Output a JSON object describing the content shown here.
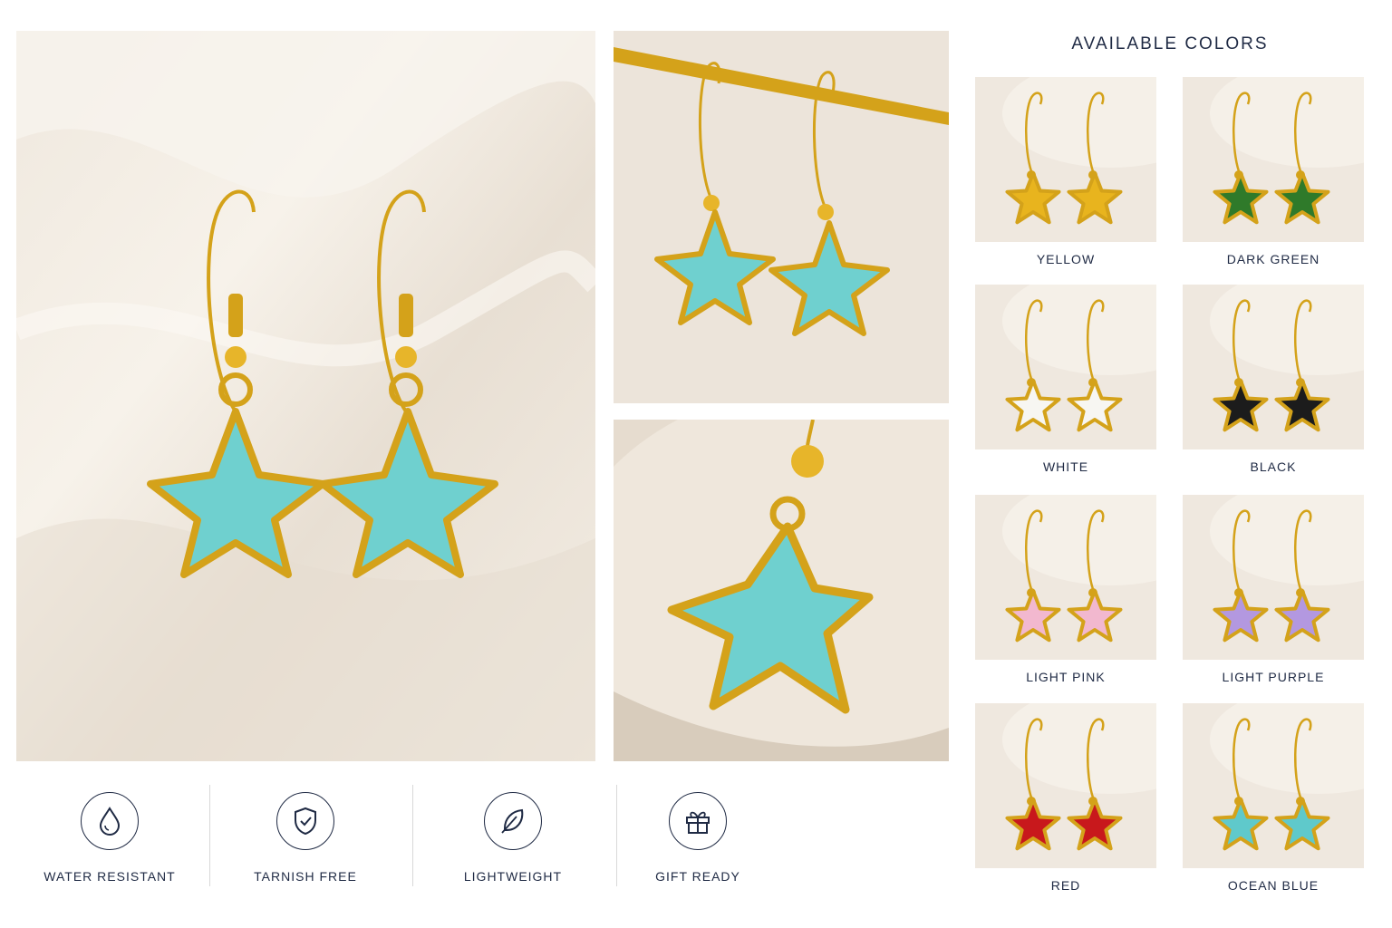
{
  "colors_section": {
    "title": "AVAILABLE COLORS",
    "options": [
      {
        "label": "YELLOW",
        "hex": "#e8b41e"
      },
      {
        "label": "DARK GREEN",
        "hex": "#2f7a2a"
      },
      {
        "label": "WHITE",
        "hex": "#f7f6f2"
      },
      {
        "label": "BLACK",
        "hex": "#1c1c1c"
      },
      {
        "label": "LIGHT PINK",
        "hex": "#f2b8cf"
      },
      {
        "label": "LIGHT PURPLE",
        "hex": "#b398e0"
      },
      {
        "label": "RED",
        "hex": "#c8181c"
      },
      {
        "label": "OCEAN BLUE",
        "hex": "#5fc9cb"
      }
    ]
  },
  "features": [
    {
      "label": "WATER RESISTANT",
      "icon": "water-drop-icon"
    },
    {
      "label": "TARNISH FREE",
      "icon": "shield-check-icon"
    },
    {
      "label": "LIGHTWEIGHT",
      "icon": "feather-icon"
    },
    {
      "label": "GIFT READY",
      "icon": "gift-icon"
    }
  ],
  "colors": {
    "gold": "#d4a21a",
    "turquoise": "#6fd0cf",
    "text": "#1f2a44",
    "divider": "#d9d9d9"
  }
}
